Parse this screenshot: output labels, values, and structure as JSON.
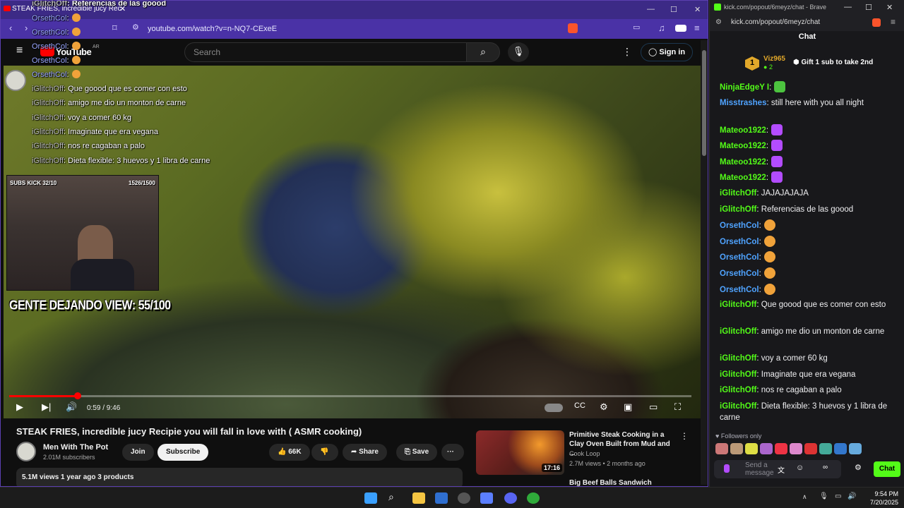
{
  "youtube_window": {
    "tab_title": "STEAK FRIES, incredible jucy Rec",
    "url": "youtube.com/watch?v=n-NQ7-CExeE",
    "header": {
      "logo": "YouTube",
      "region": "AR",
      "search_placeholder": "Search",
      "signin": "Sign in"
    },
    "overlay_chat": [
      {
        "user": "iGlitchOff",
        "text": ": Referencias de las goood"
      },
      {
        "user": "OrsethCol",
        "text": ":"
      },
      {
        "user": "OrsethCol",
        "text": ":"
      },
      {
        "user": "OrsethCol",
        "text": ":"
      },
      {
        "user": "OrsethCol",
        "text": ":"
      },
      {
        "user": "OrsethCol",
        "text": ":"
      },
      {
        "user": "iGlitchOff",
        "text": ": Que goood que es comer con esto"
      },
      {
        "user": "iGlitchOff",
        "text": ": amigo me dio un monton de carne"
      },
      {
        "user": "iGlitchOff",
        "text": ": voy a comer 60 kg"
      },
      {
        "user": "iGlitchOff",
        "text": ": Imaginate que era vegana"
      },
      {
        "user": "iGlitchOff",
        "text": ": nos re cagaban a palo"
      },
      {
        "user": "iGlitchOff",
        "text": ": Dieta flexible: 3 huevos y 1 libra de carne"
      }
    ],
    "webcam": {
      "subs_label": "SUBS KICK 32/10",
      "counter": "1526/1500"
    },
    "overlay_banner": "GENTE DEJANDO VIEW: 55/100",
    "player": {
      "time": "0:59 / 9:46",
      "progress_fraction": 0.1
    },
    "video": {
      "title": "STEAK FRIES, incredible jucy Recipie you will fall in love with ( ASMR cooking)",
      "channel": "Men With The Pot",
      "subscribers": "2.01M subscribers",
      "join": "Join",
      "subscribe": "Subscribe",
      "likes": "66K",
      "share": "Share",
      "save": "Save",
      "meta": "5.1M views  1 year ago  3 products"
    },
    "recommended": {
      "title": "Primitive Steak Cooking in a Clay Oven Built from Mud and ...",
      "channel": "Cook Loop",
      "views": "2.7M views • 2 months ago",
      "duration": "17:16",
      "next_title": "Big Beef Balls Sandwich"
    }
  },
  "kick_window": {
    "tab_title": "kick.com/popout/6meyz/chat - Brave",
    "url": "kick.com/popout/6meyz/chat",
    "header": "Chat",
    "pinned": {
      "badge": "1",
      "user": "Viz965",
      "count": "2",
      "text": "Gift 1 sub to take 2nd"
    },
    "messages": [
      {
        "user": "NinjaEdgeY I",
        "text": ":",
        "color": "#53fc18",
        "emote": "em-green"
      },
      {
        "user": "Misstrashes",
        "text": ": still here with you all night",
        "color": "#4fa3ff",
        "emote": ""
      },
      {
        "user": "Mateoo1922",
        "text": ":",
        "color": "#53fc18",
        "emote": "em-purple"
      },
      {
        "user": "Mateoo1922",
        "text": ":",
        "color": "#53fc18",
        "emote": "em-purple"
      },
      {
        "user": "Mateoo1922",
        "text": ":",
        "color": "#53fc18",
        "emote": "em-purple"
      },
      {
        "user": "Mateoo1922",
        "text": ":",
        "color": "#53fc18",
        "emote": "em-purple"
      },
      {
        "user": "iGlitchOff",
        "text": ": JAJAJAJAJA",
        "color": "#53fc18",
        "emote": ""
      },
      {
        "user": "iGlitchOff",
        "text": ": Referencias de las goood",
        "color": "#53fc18",
        "emote": ""
      },
      {
        "user": "OrsethCol",
        "text": ":",
        "color": "#4fa3ff",
        "emote": "em-orange"
      },
      {
        "user": "OrsethCol",
        "text": ":",
        "color": "#4fa3ff",
        "emote": "em-orange"
      },
      {
        "user": "OrsethCol",
        "text": ":",
        "color": "#4fa3ff",
        "emote": "em-orange"
      },
      {
        "user": "OrsethCol",
        "text": ":",
        "color": "#4fa3ff",
        "emote": "em-orange"
      },
      {
        "user": "OrsethCol",
        "text": ":",
        "color": "#4fa3ff",
        "emote": "em-orange"
      },
      {
        "user": "iGlitchOff",
        "text": ": Que goood que es comer con esto",
        "color": "#53fc18",
        "emote": ""
      },
      {
        "user": "iGlitchOff",
        "text": ": amigo me dio un monton de carne",
        "color": "#53fc18",
        "emote": ""
      },
      {
        "user": "iGlitchOff",
        "text": ": voy a comer 60 kg",
        "color": "#53fc18",
        "emote": ""
      },
      {
        "user": "iGlitchOff",
        "text": ": Imaginate que era vegana",
        "color": "#53fc18",
        "emote": ""
      },
      {
        "user": "iGlitchOff",
        "text": ": nos re cagaban a palo",
        "color": "#53fc18",
        "emote": ""
      },
      {
        "user": "iGlitchOff",
        "text": ": Dieta flexible: 3 huevos y 1 libra de carne",
        "color": "#53fc18",
        "emote": ""
      }
    ],
    "followers_only": "Followers only",
    "send_placeholder": "Send a message",
    "chat_button": "Chat"
  },
  "taskbar": {
    "time": "9:54 PM",
    "date": "7/20/2025"
  },
  "colors": {
    "youtube_red": "#ff0000",
    "kick_green": "#53fc18",
    "brave_purple": "#4a32a6"
  }
}
